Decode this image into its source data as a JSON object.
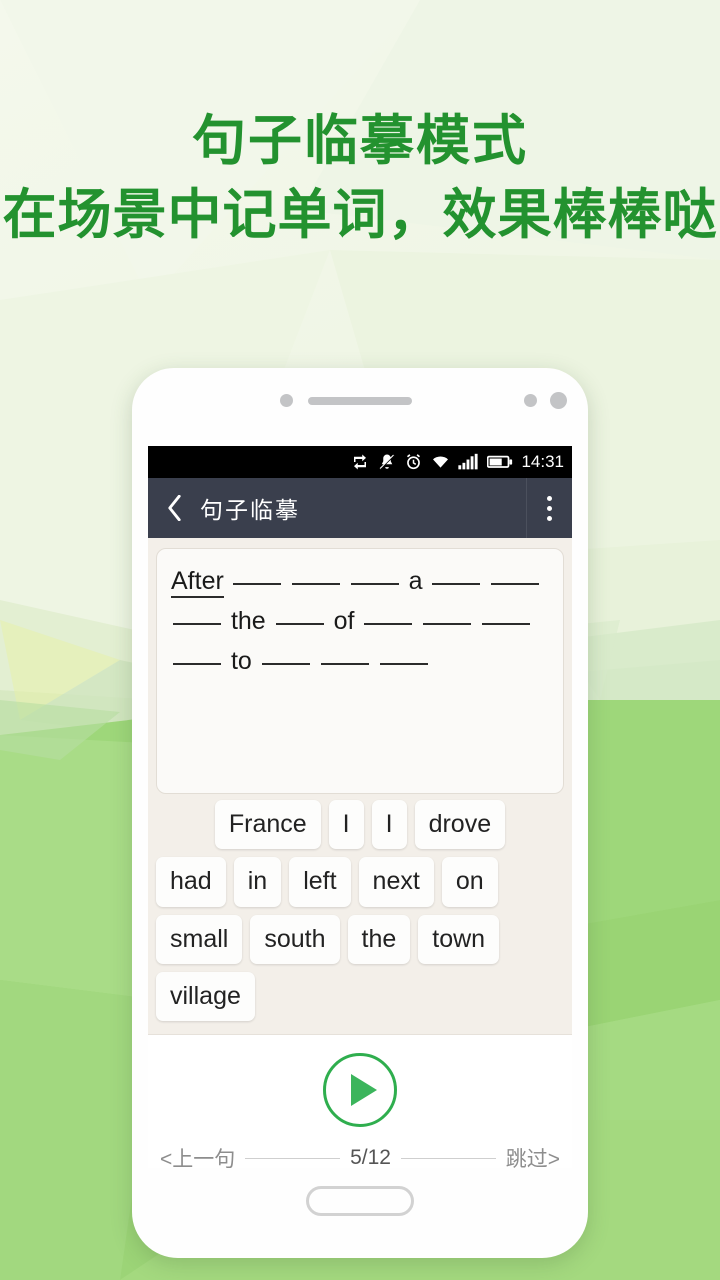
{
  "promo": {
    "headline_line1": "句子临摹模式",
    "headline_line2": "在场景中记单词，效果棒棒哒",
    "accent_color": "#23922f"
  },
  "phone": {
    "status_bar": {
      "time": "14:31",
      "icons": [
        "sync-icon",
        "bell-muted-icon",
        "alarm-clock-icon",
        "wifi-icon",
        "signal-bars-icon",
        "battery-icon"
      ]
    },
    "app_bar": {
      "back_icon": "chevron-left-icon",
      "title": "句子临摹",
      "overflow_icon": "overflow-menu-icon"
    },
    "sentence": {
      "tokens": [
        {
          "type": "word",
          "text": "After"
        },
        {
          "type": "blank"
        },
        {
          "type": "blank"
        },
        {
          "type": "blank"
        },
        {
          "type": "plain",
          "text": "a"
        },
        {
          "type": "blank"
        },
        {
          "type": "blank"
        },
        {
          "type": "blank"
        },
        {
          "type": "plain",
          "text": "the"
        },
        {
          "type": "blank"
        },
        {
          "type": "plain",
          "text": "of"
        },
        {
          "type": "blank"
        },
        {
          "type": "blank"
        },
        {
          "type": "blank"
        },
        {
          "type": "blank"
        },
        {
          "type": "plain",
          "text": "to"
        },
        {
          "type": "blank"
        },
        {
          "type": "blank"
        },
        {
          "type": "blank"
        }
      ]
    },
    "word_bank": {
      "rows": [
        [
          "France",
          "I",
          "I",
          "drove"
        ],
        [
          "had",
          "in",
          "left",
          "next",
          "on"
        ],
        [
          "small",
          "south",
          "the",
          "town"
        ],
        [
          "village"
        ]
      ]
    },
    "player": {
      "play_icon": "play-icon",
      "accent_color": "#2fae4e",
      "prev_label": "<上一句",
      "counter": "5/12",
      "skip_label": "跳过>"
    },
    "home_button_icon": "home-button"
  }
}
